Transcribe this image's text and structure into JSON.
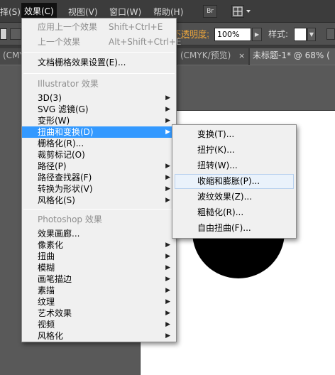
{
  "menubar": {
    "items": [
      "择(S)",
      "效果(C)",
      "视图(V)",
      "窗口(W)",
      "帮助(H)"
    ],
    "bridge_label": "Br"
  },
  "controlbar": {
    "opacity_label": "不透明度:",
    "opacity_value": "100%",
    "style_label": "样式:"
  },
  "tabs": {
    "left": "(CMYK/",
    "middle": "(CMYK/预览)",
    "close": "×",
    "active": "未标题-1* @ 68% ("
  },
  "effect_menu": {
    "apply_last": {
      "label": "应用上一个效果",
      "shortcut": "Shift+Ctrl+E"
    },
    "last_effect": {
      "label": "上一个效果",
      "shortcut": "Alt+Shift+Ctrl+E"
    },
    "doc_raster_settings": "文档栅格效果设置(E)...",
    "illustrator_header": "Illustrator 效果",
    "illustrator_items": [
      "3D(3)",
      "SVG 滤镜(G)",
      "变形(W)",
      "扭曲和变换(D)",
      "栅格化(R)...",
      "裁剪标记(O)",
      "路径(P)",
      "路径查找器(F)",
      "转换为形状(V)",
      "风格化(S)"
    ],
    "photoshop_header": "Photoshop 效果",
    "photoshop_items": [
      "效果画廊...",
      "像素化",
      "扭曲",
      "模糊",
      "画笔描边",
      "素描",
      "纹理",
      "艺术效果",
      "视频",
      "风格化"
    ]
  },
  "distort_submenu": {
    "items": [
      "变换(T)...",
      "扭拧(K)...",
      "扭转(W)...",
      "收缩和膨胀(P)...",
      "波纹效果(Z)...",
      "粗糙化(R)...",
      "自由扭曲(F)..."
    ],
    "hovered": "收缩和膨胀(P)..."
  },
  "colors": {
    "menu_highlight": "#3399ff",
    "opacity_label": "#e8a33c",
    "submenu_hover": "#eaf2fb"
  }
}
